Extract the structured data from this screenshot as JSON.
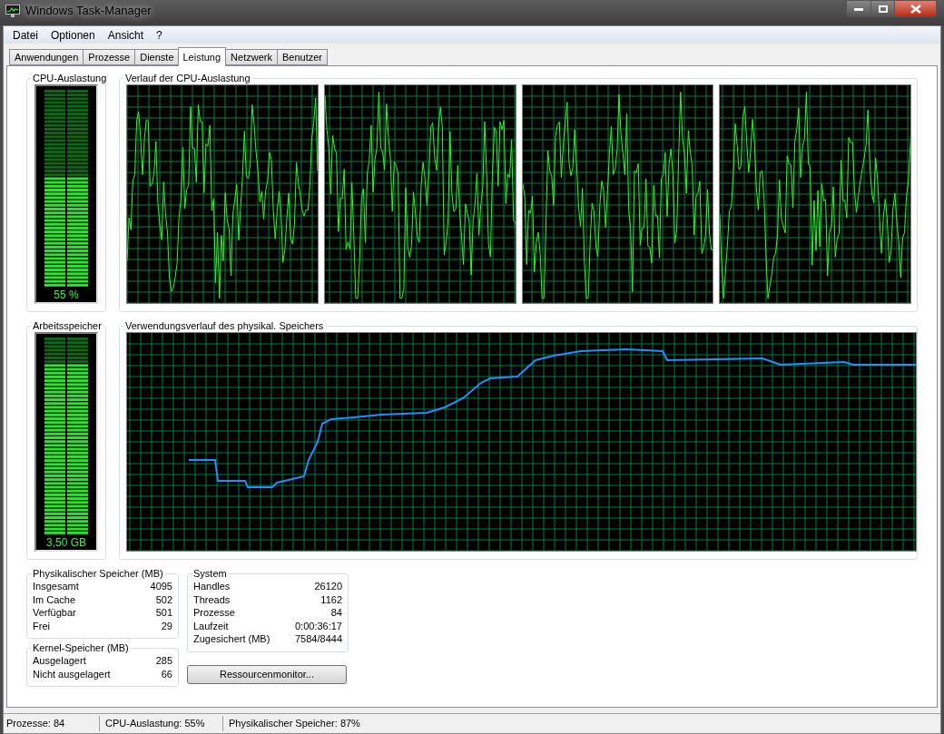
{
  "window": {
    "title": "Windows Task-Manager"
  },
  "menu": [
    "Datei",
    "Optionen",
    "Ansicht",
    "?"
  ],
  "tabs": [
    {
      "label": "Anwendungen",
      "selected": false
    },
    {
      "label": "Prozesse",
      "selected": false
    },
    {
      "label": "Dienste",
      "selected": false
    },
    {
      "label": "Leistung",
      "selected": true
    },
    {
      "label": "Netzwerk",
      "selected": false
    },
    {
      "label": "Benutzer",
      "selected": false
    }
  ],
  "cpu_usage": {
    "title": "CPU-Auslastung",
    "reading": "55 %",
    "level": 0.55
  },
  "cpu_history": {
    "title": "Verlauf der CPU-Auslastung"
  },
  "memory": {
    "title": "Arbeitsspeicher",
    "reading": "3,50 GB",
    "level": 0.87
  },
  "memory_history": {
    "title": "Verwendungsverlauf des physikal. Speichers"
  },
  "physical_memory": {
    "title": "Physikalischer Speicher (MB)",
    "rows": [
      {
        "label": "Insgesamt",
        "value": "4095"
      },
      {
        "label": "Im Cache",
        "value": "502"
      },
      {
        "label": "Verfügbar",
        "value": "501"
      },
      {
        "label": "Frei",
        "value": "29"
      }
    ]
  },
  "kernel_memory": {
    "title": "Kernel-Speicher (MB)",
    "rows": [
      {
        "label": "Ausgelagert",
        "value": "285"
      },
      {
        "label": "Nicht ausgelagert",
        "value": "66"
      }
    ]
  },
  "system": {
    "title": "System",
    "rows": [
      {
        "label": "Handles",
        "value": "26120"
      },
      {
        "label": "Threads",
        "value": "1162"
      },
      {
        "label": "Prozesse",
        "value": "84"
      },
      {
        "label": "Laufzeit",
        "value": "0:00:36:17"
      },
      {
        "label": "Zugesichert (MB)",
        "value": "7584/8444"
      }
    ]
  },
  "resource_monitor_button": "Ressourcenmonitor...",
  "status_bar": [
    "Prozesse: 84",
    "CPU-Auslastung: 55%",
    "Physikalischer Speicher: 87%"
  ]
}
